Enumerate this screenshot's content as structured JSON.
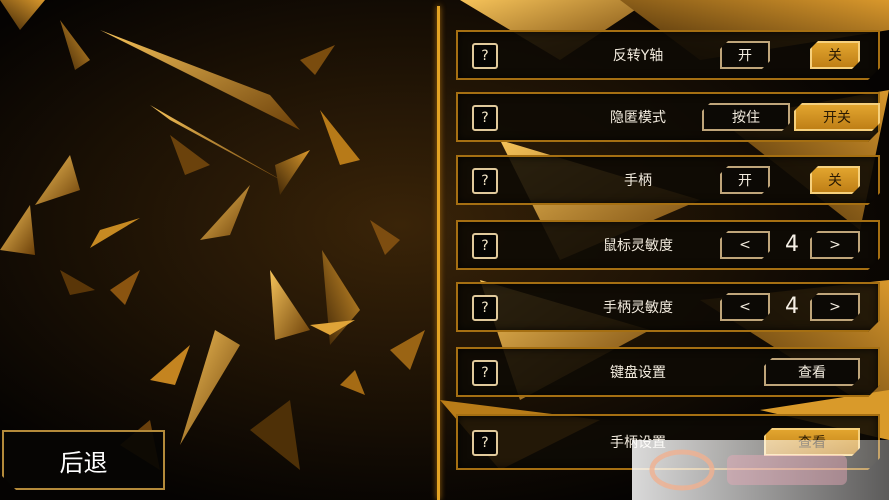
{
  "back_label": "后退",
  "help_glyph": "?",
  "settings": [
    {
      "label": "反转Y轴",
      "type": "toggle",
      "options": [
        "开",
        "关"
      ],
      "selected": "关"
    },
    {
      "label": "隐匿模式",
      "type": "toggle",
      "options": [
        "按住",
        "开关"
      ],
      "selected": "开关"
    },
    {
      "label": "手柄",
      "type": "toggle",
      "options": [
        "开",
        "关"
      ],
      "selected": "关"
    },
    {
      "label": "鼠标灵敏度",
      "type": "stepper",
      "decrement": "<",
      "increment": ">",
      "value": "4"
    },
    {
      "label": "手柄灵敏度",
      "type": "stepper",
      "decrement": "<",
      "increment": ">",
      "value": "4"
    },
    {
      "label": "键盘设置",
      "type": "action",
      "button": "查看"
    },
    {
      "label": "手柄设置",
      "type": "action",
      "button": "查看"
    }
  ],
  "colors": {
    "accent": "#e2a52f",
    "panel_border": "#a56f12",
    "background": "#0b0804"
  }
}
